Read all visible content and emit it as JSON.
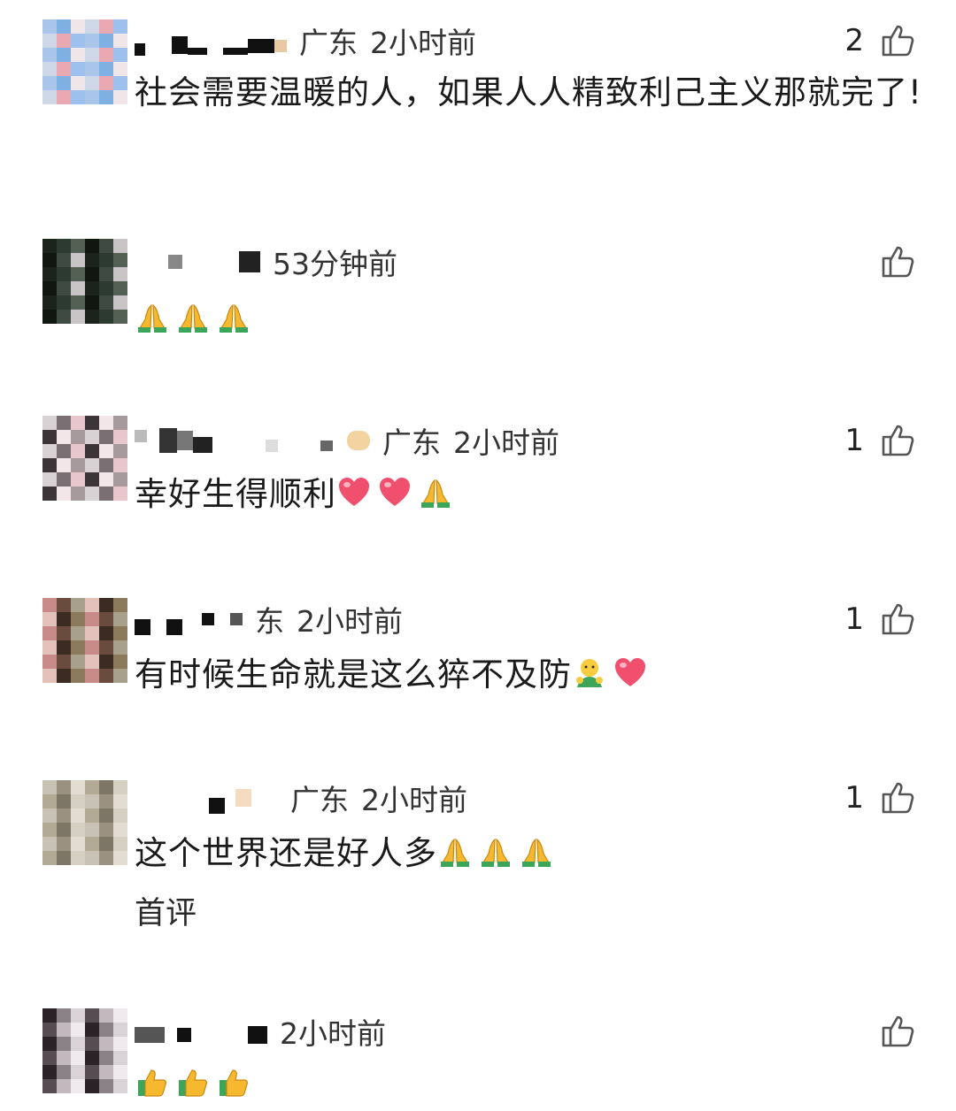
{
  "comments": [
    {
      "location": "广东",
      "time": "2小时前",
      "likes": "2",
      "text": "社会需要温暖的人，如果人人精致利己主义那就完了!",
      "avatar_palette": [
        "#a9c6ea",
        "#7fb0e3",
        "#f0e6e9",
        "#cfd8e6",
        "#e8a9b3",
        "#9ec0ef"
      ]
    },
    {
      "location": "",
      "time": "53分钟前",
      "likes": "",
      "text": "",
      "emoji": [
        "pray",
        "pray",
        "pray"
      ],
      "avatar_palette": [
        "#1c231c",
        "#2d3a30",
        "#556055",
        "#0f1710",
        "#3f4a42",
        "#c9c4c6"
      ]
    },
    {
      "location": "广东",
      "time": "2小时前",
      "likes": "1",
      "text": "幸好生得顺利",
      "emoji": [
        "heart",
        "heart",
        "pray"
      ],
      "avatar_palette": [
        "#d7d2d4",
        "#7a6f72",
        "#e8c6cb",
        "#3b3537",
        "#f3e6e8",
        "#a69a9d"
      ]
    },
    {
      "location": "东",
      "time": "2小时前",
      "likes": "1",
      "text": "有时候生命就是这么猝不及防",
      "emoji": [
        "hug",
        "heart"
      ],
      "avatar_palette": [
        "#c98b88",
        "#6b4b3e",
        "#a8a08c",
        "#e5c1bc",
        "#3a2c22",
        "#8c7a5c"
      ]
    },
    {
      "location": "广东",
      "time": "2小时前",
      "likes": "1",
      "text": "这个世界还是好人多",
      "emoji": [
        "pray",
        "pray",
        "pray"
      ],
      "tag": "首评",
      "avatar_palette": [
        "#c8c2b5",
        "#9a9180",
        "#e2ddd2",
        "#b3aa96",
        "#7d7565",
        "#d6d0c3"
      ]
    },
    {
      "location": "",
      "time": "2小时前",
      "likes": "",
      "text": "",
      "emoji": [
        "thumbs",
        "thumbs",
        "thumbs"
      ],
      "avatar_palette": [
        "#2a2226",
        "#8b8287",
        "#d9d2d6",
        "#574c52",
        "#c4b8bf",
        "#efeaee"
      ]
    }
  ],
  "icons": {
    "like": "thumbs-up-outline-icon"
  },
  "colors": {
    "text": "#1a1a1a",
    "meta": "#333333",
    "icon": "#555555"
  }
}
